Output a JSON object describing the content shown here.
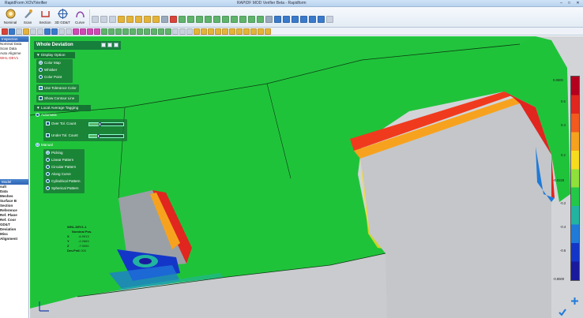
{
  "window": {
    "title": "RapidForm XOV/Verifier",
    "center_title": "RAPIDF MOD Verifier Beta - Rapidform"
  },
  "ribbon": {
    "tools": [
      {
        "label": "Nominal",
        "icon": "nominal-icon"
      },
      {
        "label": "Scan",
        "icon": "scan-icon"
      },
      {
        "label": "Section",
        "icon": "section-icon"
      },
      {
        "label": "3D GD&T",
        "icon": "gdt-icon"
      },
      {
        "label": "Curve",
        "icon": "curve-icon"
      }
    ]
  },
  "left_panel": {
    "header_top": "Inspection",
    "items_top": [
      "Nominal Data",
      "Scan Data",
      "Auto Alignme",
      "WHL-DEV1"
    ],
    "header_bottom": "Model",
    "items_bottom": [
      "sult",
      "Data",
      "Meshes",
      "Surface B",
      "Section",
      "Reference",
      "Ref. Plane",
      "Ref. Coor",
      "GD&T",
      "Deviation",
      "Misc",
      "Alignment"
    ]
  },
  "deviation_panel": {
    "title": "Whole Deviation",
    "display_option": {
      "label": "Display Option",
      "modes": [
        "Color Map",
        "Whisker",
        "Color Point"
      ],
      "selected": "Color Map",
      "use_tolerance_color": "Use Tolerance Color",
      "show_contour_line": "Show Contour Line"
    },
    "local_average": {
      "label": "Local Average Tagging",
      "automatic": "Automatic",
      "over_tol_count": "Over Tol. Count",
      "under_tol_count": "Under Tol. Count",
      "manual": "Manual",
      "patterns": [
        "Picking",
        "Linear Pattern",
        "Circular Pattern",
        "Along Curve",
        "Cylindrical Pattern",
        "Spherical Pattern"
      ],
      "selected": "Picking"
    }
  },
  "annotation": {
    "name": "WHL-DEV1-1",
    "heading": "Nominal Pos.",
    "rows": [
      {
        "k": "X",
        "v": "-6.9913"
      },
      {
        "k": "Y",
        "v": "-2.2663"
      },
      {
        "k": "Z",
        "v": "-7.0000"
      },
      {
        "k": "Dev.Pnt",
        "v": "0.000"
      }
    ]
  },
  "colorbar": {
    "labels": [
      "0.8500",
      "0.6",
      "0.4",
      "0.2",
      "-0.0228",
      "-0.2",
      "-0.4",
      "-0.6",
      "-0.8500"
    ],
    "colors": [
      "#b4001e",
      "#e0261e",
      "#f25a1e",
      "#f7a21e",
      "#f7dc1e",
      "#8fe03a",
      "#23c848",
      "#22b4a0",
      "#1f7ad8",
      "#1436c8",
      "#1a1a9e"
    ]
  }
}
